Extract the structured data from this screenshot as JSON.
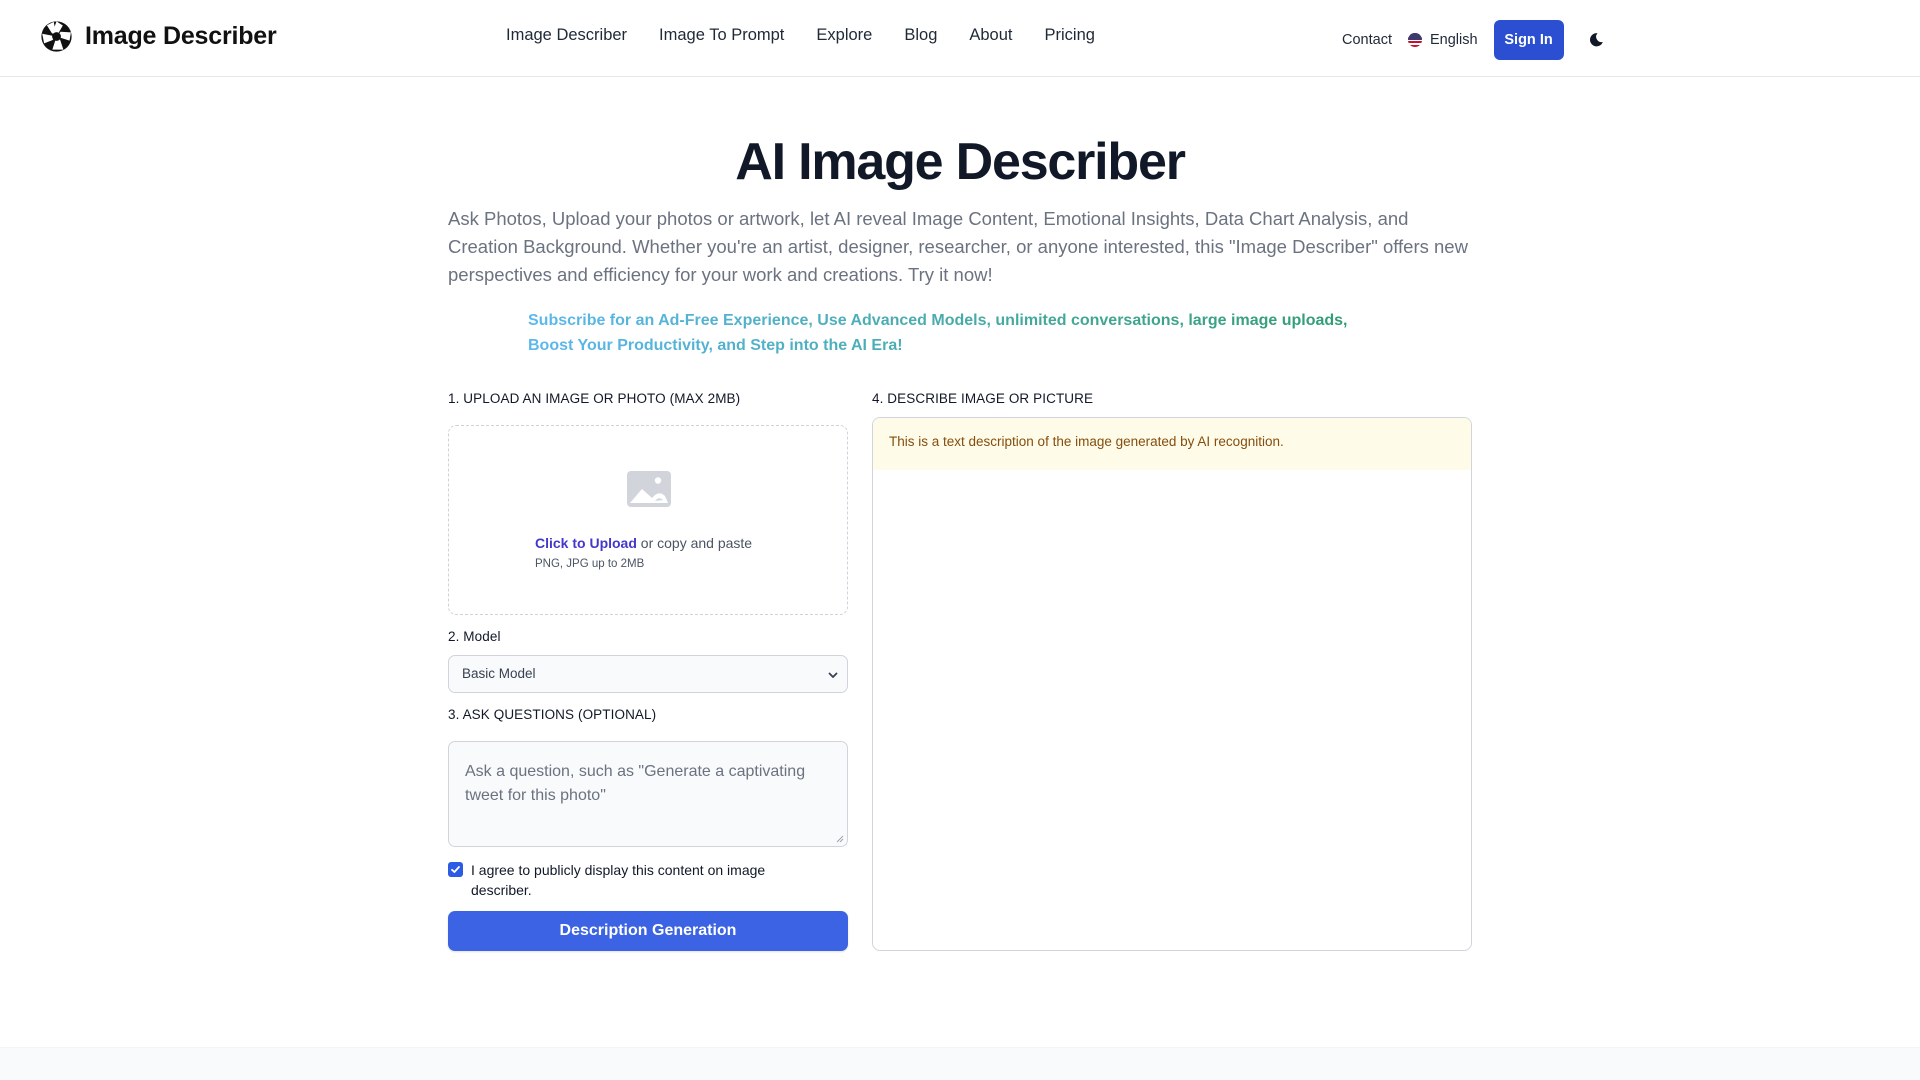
{
  "header": {
    "brand": "Image Describer",
    "logo_icon": "aperture-icon",
    "nav": [
      {
        "label": "Image Describer"
      },
      {
        "label": "Image To Prompt"
      },
      {
        "label": "Explore"
      },
      {
        "label": "Blog"
      },
      {
        "label": "About"
      },
      {
        "label": "Pricing"
      }
    ],
    "contact": "Contact",
    "language": {
      "label": "English",
      "icon": "us-flag-icon"
    },
    "sign_in": "Sign In",
    "theme_icon": "moon-icon",
    "accent_color": "#2c4fd1"
  },
  "hero": {
    "title": "AI Image Describer",
    "intro": "Ask Photos, Upload your photos or artwork, let AI reveal Image Content, Emotional Insights, Data Chart Analysis, and Creation Background. Whether you're an artist, designer, researcher, or anyone interested, this \"Image Describer\" offers new perspectives and efficiency for your work and creations. Try it now!",
    "subscribe": "Subscribe for an Ad-Free Experience, Use Advanced Models, unlimited conversations, large image uploads, Boost Your Productivity, and Step into the AI Era!"
  },
  "form": {
    "upload": {
      "label": "1. UPLOAD AN IMAGE OR PHOTO (MAX 2MB)",
      "icon": "image-placeholder-icon",
      "link": "Click to Upload",
      "text": " or copy and paste",
      "hint": "PNG, JPG up to 2MB"
    },
    "model": {
      "label": "2. Model",
      "selected": "Basic Model"
    },
    "questions": {
      "label": "3. ASK QUESTIONS (OPTIONAL)",
      "placeholder": "Ask a question, such as \"Generate a captivating tweet for this photo\"",
      "value": ""
    },
    "agree": {
      "checked": true,
      "label": "I agree to publicly display this content on image describer."
    },
    "submit": "Description Generation"
  },
  "result": {
    "label": "4. DESCRIBE IMAGE OR PICTURE",
    "notice": "This is a text description of the image generated by AI recognition."
  }
}
